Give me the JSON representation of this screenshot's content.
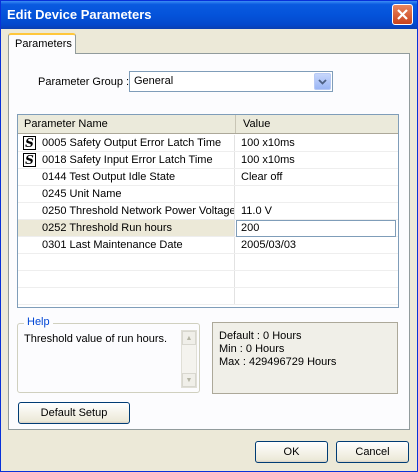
{
  "window": {
    "title": "Edit Device Parameters"
  },
  "tabs": [
    {
      "label": "Parameters",
      "active": true
    }
  ],
  "parameter_group": {
    "label": "Parameter Group :",
    "selected": "General"
  },
  "grid": {
    "columns": [
      "Parameter Name",
      "Value"
    ],
    "rows": [
      {
        "safety_icon": true,
        "name": "0005 Safety Output Error Latch Time",
        "value": "100 x10ms"
      },
      {
        "safety_icon": true,
        "name": "0018 Safety Input Error Latch Time",
        "value": "100 x10ms"
      },
      {
        "safety_icon": false,
        "name": "0144 Test Output Idle State",
        "value": "Clear off"
      },
      {
        "safety_icon": false,
        "name": "0245 Unit Name",
        "value": ""
      },
      {
        "safety_icon": false,
        "name": "0250 Threshold Network Power Voltage",
        "value": "11.0 V"
      },
      {
        "safety_icon": false,
        "name": "0252 Threshold Run hours",
        "value": "200",
        "selected": true
      },
      {
        "safety_icon": false,
        "name": "0301 Last Maintenance Date",
        "value": "2005/03/03"
      }
    ]
  },
  "help": {
    "title": "Help",
    "text": "Threshold value of run hours."
  },
  "info": {
    "default": "Default : 0 Hours",
    "min": "Min : 0 Hours",
    "max": "Max : 429496729 Hours"
  },
  "buttons": {
    "default_setup": "Default Setup",
    "ok": "OK",
    "cancel": "Cancel"
  },
  "icons": {
    "safety": "safety-s-icon",
    "close": "close-icon",
    "dropdown": "chevron-down-icon"
  },
  "colors": {
    "titlebar": "#0453da",
    "help_title": "#0046d5",
    "tab_highlight": "#ffc73c"
  }
}
